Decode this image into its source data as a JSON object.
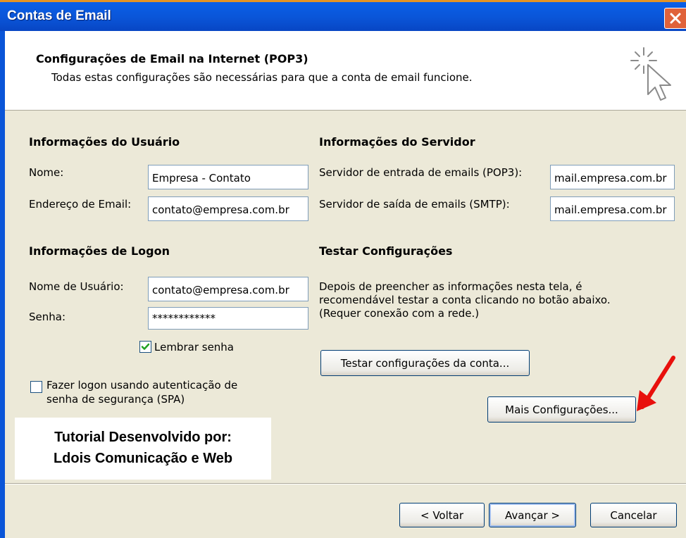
{
  "window": {
    "title": "Contas de Email"
  },
  "header": {
    "title": "Configurações de Email na Internet (POP3)",
    "subtitle": "Todas estas configurações são necessárias para que a conta de email funcione."
  },
  "user_info": {
    "heading": "Informações do Usuário",
    "name_label": "Nome:",
    "name_value": "Empresa - Contato",
    "email_label": "Endereço de Email:",
    "email_value": "contato@empresa.com.br"
  },
  "server_info": {
    "heading": "Informações do Servidor",
    "incoming_label": "Servidor de entrada de emails (POP3):",
    "incoming_value": "mail.empresa.com.br",
    "outgoing_label": "Servidor de saída de emails (SMTP):",
    "outgoing_value": "mail.empresa.com.br"
  },
  "logon_info": {
    "heading": "Informações de Logon",
    "username_label": "Nome de Usuário:",
    "username_value": "contato@empresa.com.br",
    "password_label": "Senha:",
    "password_value": "************",
    "remember_label": "Lembrar senha",
    "remember_checked": true,
    "spa_label_line1": "Fazer logon usando autenticação de",
    "spa_label_line2": "senha de segurança (SPA)",
    "spa_checked": false
  },
  "test_settings": {
    "heading": "Testar Configurações",
    "description": "Depois de preencher as informações nesta tela, é recomendável testar a conta clicando no botão abaixo. (Requer conexão com a rede.)",
    "test_button": "Testar configurações da conta...",
    "more_button": "Mais Configurações..."
  },
  "watermark": {
    "line1": "Tutorial Desenvolvido por:",
    "line2": "Ldois Comunicação e Web"
  },
  "footer": {
    "back_button": "< Voltar",
    "next_button": "Avançar >",
    "cancel_button": "Cancelar"
  },
  "colors": {
    "titlebar": "#0a56d9",
    "dialog_bg": "#ece9d8",
    "arrow": "#e8100c",
    "checkmark": "#21a121"
  },
  "icons": [
    "close-icon",
    "cursor-sparkle-icon",
    "checkmark-icon",
    "red-arrow-icon"
  ]
}
